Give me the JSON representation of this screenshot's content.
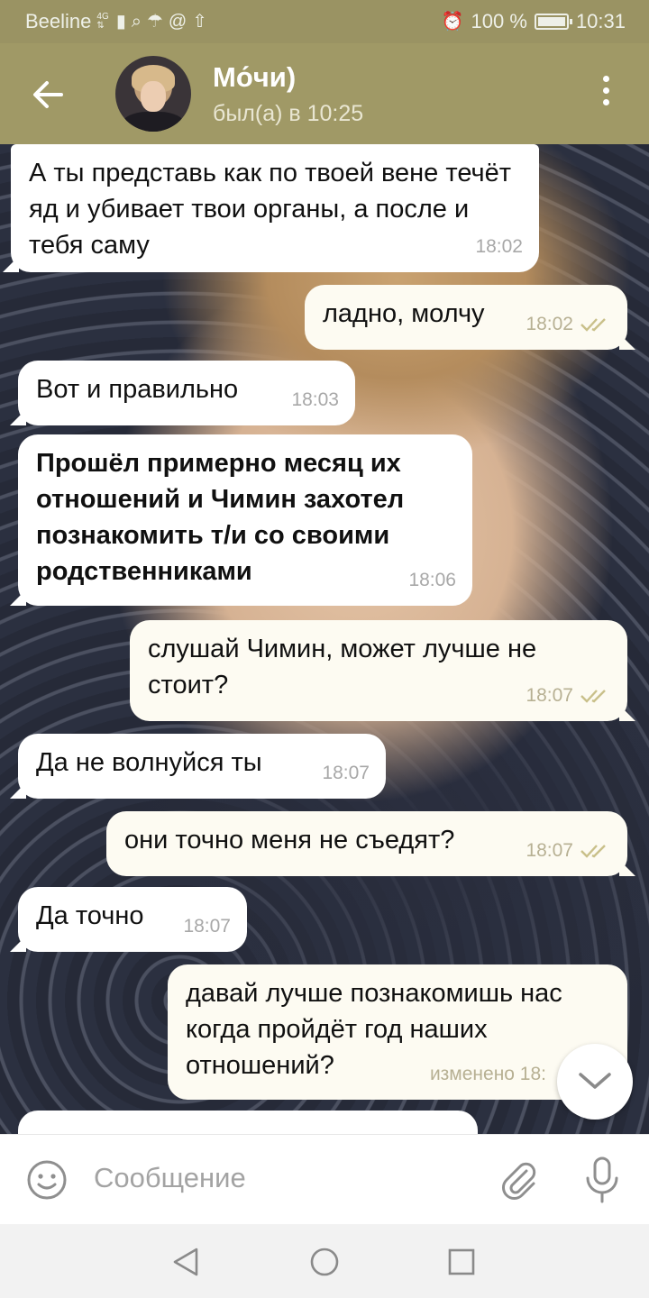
{
  "status_bar": {
    "carrier": "Beeline",
    "network": "4G",
    "battery": "100 %",
    "battery_level": 1.0,
    "time": "10:31"
  },
  "header": {
    "contact_name": "Мо́чи)",
    "last_seen": "был(а) в 10:25",
    "back_icon": "arrow-left-icon",
    "menu_icon": "more-vertical-icon"
  },
  "messages": [
    {
      "dir": "in",
      "text": "А ты представь как по твоей вене течёт яд и убивает твои органы, а после и тебя саму",
      "time": "18:02"
    },
    {
      "dir": "out",
      "text": "ладно, молчу",
      "time": "18:02"
    },
    {
      "dir": "in",
      "text": "Вот и правильно",
      "time": "18:03"
    },
    {
      "dir": "in",
      "text": "Прошёл примерно месяц их отношений и Чимин захотел познакомить т/и со своими родственниками",
      "time": "18:06",
      "bold": true
    },
    {
      "dir": "out",
      "text": "слушай Чимин, может лучше не стоит?",
      "time": "18:07"
    },
    {
      "dir": "in",
      "text": "Да не волнуйся ты",
      "time": "18:07"
    },
    {
      "dir": "out",
      "text": "они точно меня не съедят?",
      "time": "18:07"
    },
    {
      "dir": "in",
      "text": "Да точно",
      "time": "18:07"
    },
    {
      "dir": "out",
      "text": "давай лучше познакомишь нас когда пройдёт год наших отношений?",
      "time": "изменено 18:"
    }
  ],
  "composer": {
    "placeholder": "Сообщение"
  },
  "colors": {
    "header_bg": "#a09966",
    "status_bg": "#9a9363",
    "incoming_bubble": "#ffffff",
    "outgoing_bubble": "#fdfbf2",
    "read_check": "#c9c08a"
  }
}
